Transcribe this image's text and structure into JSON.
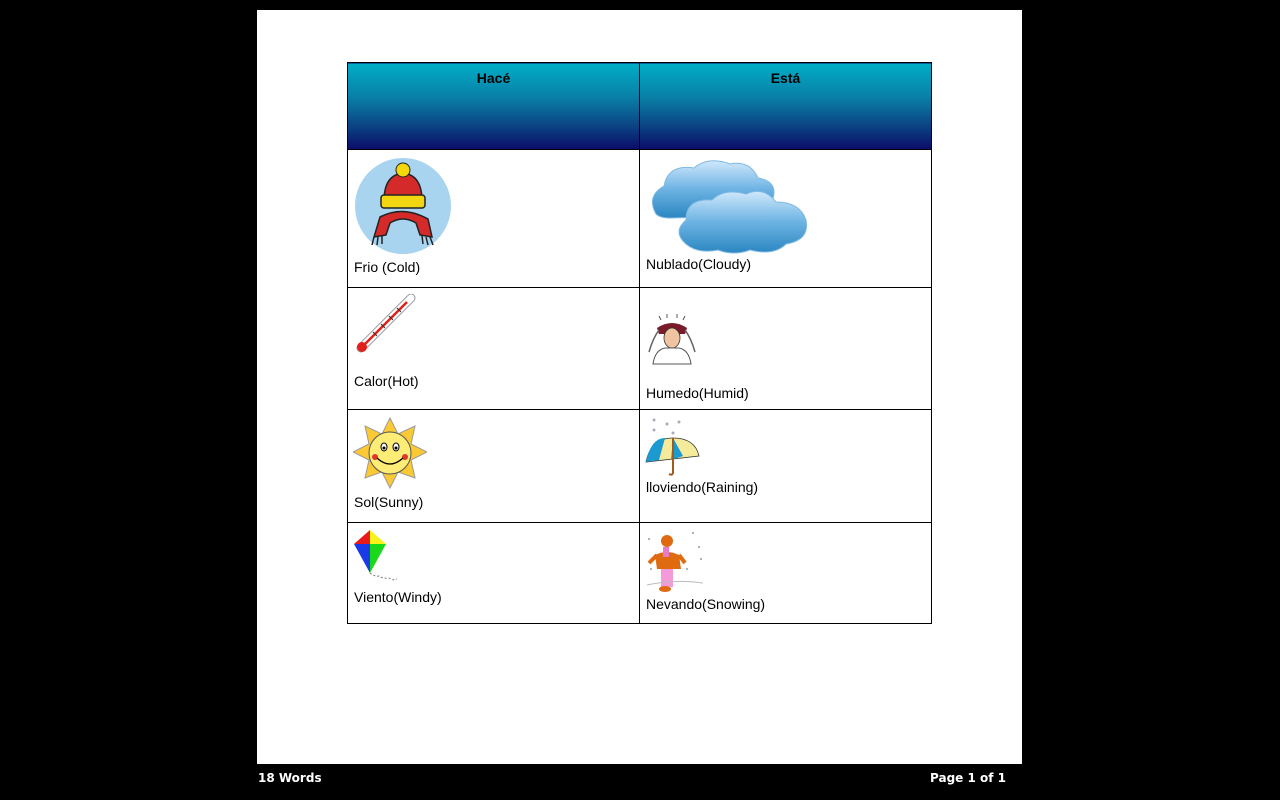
{
  "document": {
    "table": {
      "headers": [
        "Hacé",
        "Está"
      ],
      "rows": [
        {
          "left": {
            "label": "Frio (Cold)",
            "icon": "winter-hat-scarf-icon"
          },
          "right": {
            "label": "Nublado(Cloudy)",
            "icon": "clouds-icon"
          }
        },
        {
          "left": {
            "label": "Calor(Hot)",
            "icon": "thermometer-icon"
          },
          "right": {
            "label": "Humedo(Humid)",
            "icon": "frustrated-person-icon"
          }
        },
        {
          "left": {
            "label": "Sol(Sunny)",
            "icon": "smiling-sun-icon"
          },
          "right": {
            "label": "lloviendo(Raining)",
            "icon": "umbrella-rain-icon"
          }
        },
        {
          "left": {
            "label": "Viento(Windy)",
            "icon": "kite-icon"
          },
          "right": {
            "label": "Nevando(Snowing)",
            "icon": "child-in-snow-icon"
          }
        }
      ]
    }
  },
  "status_bar": {
    "word_count": "18 Words",
    "page_indicator": "Page 1 of 1"
  }
}
